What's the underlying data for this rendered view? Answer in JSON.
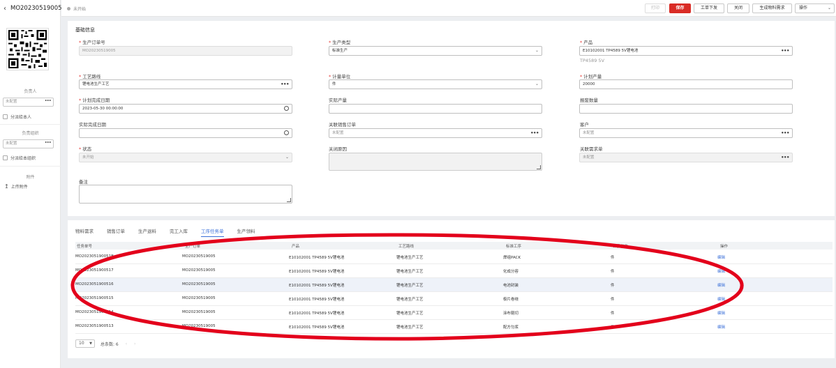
{
  "sidebar": {
    "back_icon": "chevron-left-icon",
    "order_no": "MO20230519005",
    "owner_label": "负责人",
    "owner_placeholder": "未配置",
    "owner_dots": "•••",
    "owner_subordinate": "分派给本人",
    "org_label": "负责组织",
    "org_placeholder": "未配置",
    "org_dots": "•••",
    "org_subordinate": "分派给本组织",
    "attachment_label": "附件",
    "upload_label": "上传附件"
  },
  "toolbar": {
    "status": "未开始",
    "print": "打印",
    "save": "保存",
    "issue": "工单下发",
    "close": "关闭",
    "gen_material": "生成物料需求",
    "ops": "操作"
  },
  "form": {
    "section_title": "基础信息",
    "order_no_label": "生产订单号",
    "order_no_value": "MO20230519005",
    "type_label": "生产类型",
    "type_value": "标准生产",
    "product_label": "产品",
    "product_value": "E10102001 TP4589 5V锂电池",
    "product_hint": "TP4589 5V",
    "route_label": "工艺路线",
    "route_value": "锂电池生产工艺",
    "unit_label": "计量单位",
    "unit_value": "件",
    "plan_qty_label": "计划产量",
    "plan_qty_value": "20000",
    "plan_date_label": "计划完成日期",
    "plan_date_value": "2023-05-30 00:00:00",
    "actual_qty_label": "实际产量",
    "scrap_qty_label": "报废数量",
    "actual_date_label": "实际完成日期",
    "sales_order_label": "关联销售订单",
    "sales_order_placeholder": "未配置",
    "customer_label": "客户",
    "customer_placeholder": "未配置",
    "status_label": "状态",
    "status_value": "未开始",
    "close_reason_label": "关闭原因",
    "req_label": "关联需求单",
    "req_placeholder": "未配置",
    "remark_label": "备注",
    "dots": "•••"
  },
  "tabs": [
    "物料需求",
    "销售订单",
    "生产退料",
    "完工入库",
    "工序任务单",
    "生产领料"
  ],
  "table": {
    "headers": [
      "任务单号",
      "生产订单",
      "产品",
      "工艺路线",
      "标准工序",
      "计量单位",
      "操作"
    ],
    "rows": [
      [
        "MO202305190051B",
        "MO20230519005",
        "E10102001 TP4589 5V锂电池",
        "锂电池生产工艺",
        "焊组PACK",
        "件",
        "编辑"
      ],
      [
        "MO2023051900517",
        "MO20230519005",
        "E10102001 TP4589 5V锂电池",
        "锂电池生产工艺",
        "化成分容",
        "件",
        "编辑"
      ],
      [
        "MO2023051900516",
        "MO20230519005",
        "E10102001 TP4589 5V锂电池",
        "锂电池生产工艺",
        "电池封装",
        "件",
        "编辑"
      ],
      [
        "MO2023051900515",
        "MO20230519005",
        "E10102001 TP4589 5V锂电池",
        "锂电池生产工艺",
        "极片卷绕",
        "件",
        "编辑"
      ],
      [
        "MO2023051900514",
        "MO20230519005",
        "E10102001 TP4589 5V锂电池",
        "锂电池生产工艺",
        "涂布辊切",
        "件",
        "编辑"
      ],
      [
        "MO2023051900513",
        "MO20230519005",
        "E10102001 TP4589 5V锂电池",
        "锂电池生产工艺",
        "配方匀浆",
        "件",
        "编辑"
      ]
    ]
  },
  "pager": {
    "page_size": "10",
    "total": "总条数: 6"
  },
  "colors": {
    "primary": "#d92b25",
    "link": "#3a6fd8",
    "annotation": "#e3001b"
  }
}
